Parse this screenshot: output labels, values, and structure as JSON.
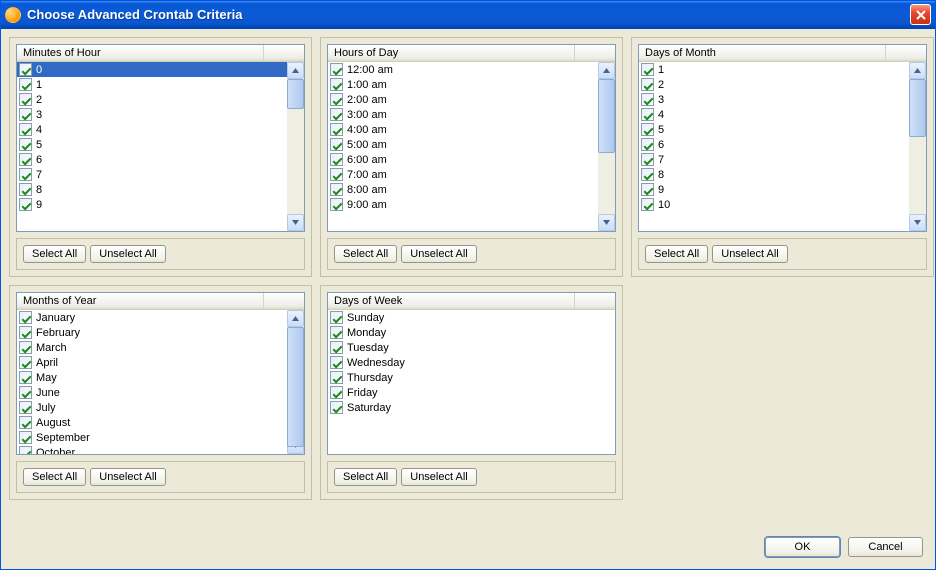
{
  "title": "Choose Advanced Crontab Criteria",
  "closeIconName": "close-icon",
  "panels": {
    "minutes": {
      "header": "Minutes of Hour",
      "selectAll": "Select All",
      "unselectAll": "Unselect All",
      "selectedIndex": 0,
      "showScrollbar": true,
      "thumbHeight": 30,
      "visible": [
        "0",
        "1",
        "2",
        "3",
        "4",
        "5",
        "6",
        "7",
        "8",
        "9"
      ]
    },
    "hours": {
      "header": "Hours of Day",
      "selectAll": "Select All",
      "unselectAll": "Unselect All",
      "selectedIndex": -1,
      "showScrollbar": true,
      "thumbHeight": 74,
      "visible": [
        "12:00 am",
        "1:00 am",
        "2:00 am",
        "3:00 am",
        "4:00 am",
        "5:00 am",
        "6:00 am",
        "7:00 am",
        "8:00 am",
        "9:00 am"
      ]
    },
    "daysOfMonth": {
      "header": "Days of Month",
      "selectAll": "Select All",
      "unselectAll": "Unselect All",
      "selectedIndex": -1,
      "showScrollbar": true,
      "thumbHeight": 58,
      "visible": [
        "1",
        "2",
        "3",
        "4",
        "5",
        "6",
        "7",
        "8",
        "9",
        "10"
      ]
    },
    "months": {
      "header": "Months of Year",
      "selectAll": "Select All",
      "unselectAll": "Unselect All",
      "selectedIndex": -1,
      "showScrollbar": true,
      "thumbHeight": 120,
      "visible": [
        "January",
        "February",
        "March",
        "April",
        "May",
        "June",
        "July",
        "August",
        "September",
        "October"
      ]
    },
    "daysOfWeek": {
      "header": "Days of Week",
      "selectAll": "Select All",
      "unselectAll": "Unselect All",
      "selectedIndex": -1,
      "showScrollbar": false,
      "visible": [
        "Sunday",
        "Monday",
        "Tuesday",
        "Wednesday",
        "Thursday",
        "Friday",
        "Saturday"
      ]
    }
  },
  "dialogButtons": {
    "ok": "OK",
    "cancel": "Cancel"
  }
}
